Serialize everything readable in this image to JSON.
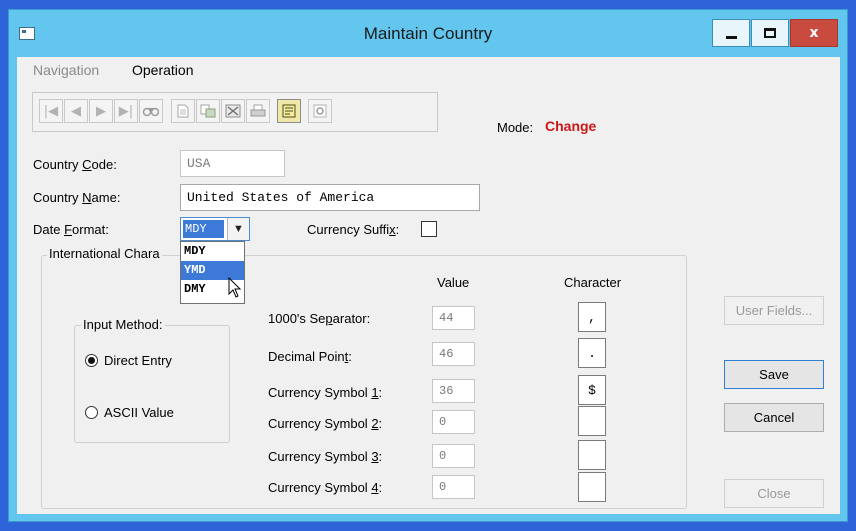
{
  "window": {
    "title": "Maintain Country",
    "controls": {
      "minimize": "minimize",
      "maximize": "maximize",
      "close": "x"
    }
  },
  "menu": {
    "navigation": "Navigation",
    "operation": "Operation"
  },
  "toolbar": {
    "icons": [
      "first-record-icon",
      "previous-record-icon",
      "next-record-icon",
      "last-record-icon",
      "find-icon",
      "new-record-icon",
      "copy-record-icon",
      "delete-record-icon",
      "print-icon",
      "change-record-icon",
      "view-icon"
    ]
  },
  "mode": {
    "label": "Mode:",
    "value": "Change",
    "color": "#c81818"
  },
  "form": {
    "country_code": {
      "label_pre": "Country ",
      "label_key": "C",
      "label_post": "ode:",
      "value": "USA"
    },
    "country_name": {
      "label_pre": "Country ",
      "label_key": "N",
      "label_post": "ame:",
      "value": "United States of America"
    },
    "date_format": {
      "label_pre": "Date ",
      "label_key": "F",
      "label_post": "ormat:",
      "value": "MDY",
      "options": [
        "MDY",
        "YMD",
        "DMY"
      ],
      "highlighted": "YMD"
    },
    "currency_suffix": {
      "label_pre": "Currency Suffi",
      "label_key": "x",
      "label_post": ":",
      "checked": false
    }
  },
  "international": {
    "title": "International Chara",
    "headers": {
      "value": "Value",
      "character": "Character"
    },
    "input_method": {
      "title": "Input Method:",
      "direct": "Direct Entry",
      "ascii": "ASCII Value",
      "selected": "Direct Entry"
    },
    "rows": [
      {
        "label_pre": "1000's Se",
        "label_key": "p",
        "label_post": "arator:",
        "value": "44",
        "character": ","
      },
      {
        "label_pre": "Decimal Poin",
        "label_key": "t",
        "label_post": ":",
        "value": "46",
        "character": "."
      },
      {
        "label_pre": "Currency Symbol ",
        "label_key": "1",
        "label_post": ":",
        "value": "36",
        "character": "$"
      },
      {
        "label_pre": "Currency Symbol ",
        "label_key": "2",
        "label_post": ":",
        "value": "0",
        "character": ""
      },
      {
        "label_pre": "Currency Symbol ",
        "label_key": "3",
        "label_post": ":",
        "value": "0",
        "character": ""
      },
      {
        "label_pre": "Currency Symbol ",
        "label_key": "4",
        "label_post": ":",
        "value": "0",
        "character": ""
      }
    ]
  },
  "buttons": {
    "user_fields": "User Fields...",
    "save": "Save",
    "cancel": "Cancel",
    "close": "Close"
  }
}
